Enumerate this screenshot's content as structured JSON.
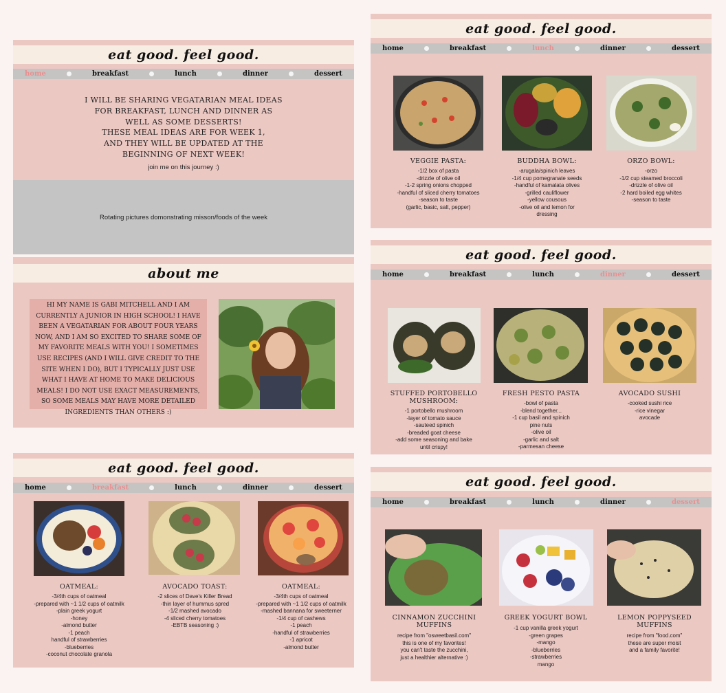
{
  "site_title": "eat good. feel good.",
  "nav": [
    "home",
    "breakfast",
    "lunch",
    "dinner",
    "dessert"
  ],
  "home": {
    "intro1": "I will be sharing vegatarian meal ideas for breakfast, lunch and dinner as well as some desserts!",
    "intro2": "These meal ideas are for week 1, and they will be updated at the beginning of next week!",
    "journey": "join me on this journey :)",
    "banner": "Rotating pictures domonstrating misson/foods of the week"
  },
  "about": {
    "title": "about me",
    "text": "Hi my name is Gabi Mitchell and I am currently a junior in high school! I have been a vegatarian for about four years now, and I am so excited to share some of my favorite meals with you! I sometimes use recipes (and I will give credit to the site when I do), but I typically just use what I have at home to make delicious meals! I do not use exact measurements, so some meals may have more detailed ingredients than others :)"
  },
  "breakfast": [
    {
      "title": "Oatmeal:",
      "lines": [
        "-3/4th cups of oatmeal",
        "-prepared with ~1 1/2 cups of oatmilk",
        "-plain greek yogurt",
        "-honey",
        "-almond butter",
        "-1 peach",
        "handful of strawberries",
        "-blueberries",
        "-coconut chocolate granola"
      ]
    },
    {
      "title": "Avocado Toast:",
      "lines": [
        "-2 slices of Dave's Killer Bread",
        "-thin layer of hummus spred",
        "-1/2 mashed avocado",
        "-4 sliced cherry tomatoes",
        "-EBTB seasoning :)"
      ]
    },
    {
      "title": "Oatmeal:",
      "lines": [
        "-3/4th cups of oatmeal",
        "-prepared with ~1 1/2 cups of oatmilk",
        "-mashed bannana for sweeterner",
        "-1/4 cup of cashews",
        "-1 peach",
        "-handful of strawberries",
        "-1 apricot",
        "-almond butter"
      ]
    }
  ],
  "lunch": [
    {
      "title": "Veggie Pasta:",
      "lines": [
        "-1/2 box of pasta",
        "-drizzle of olive oil",
        "-1-2 spring onions chopped",
        "-handful of sliced cherry tomatoes",
        "-season to taste",
        "(garlic, basic, salt, pepper)"
      ]
    },
    {
      "title": "Buddha Bowl:",
      "lines": [
        "-arugala/spinich leaves",
        "-1/4 cup pomegranate seeds",
        "-handful of kamalata olives",
        "-grilled cauliflower",
        "-yellow cousous",
        "-olive oil and lemon for",
        "dressing"
      ]
    },
    {
      "title": "orzo bowl:",
      "lines": [
        "-orzo",
        "-1/2 cup steamed broccoli",
        "-drizzle of olive oil",
        "-2 hard boiled egg whites",
        "-season to taste"
      ]
    }
  ],
  "dinner": [
    {
      "title": "Stuffed Portobello Mushroom:",
      "lines": [
        "-1 portobello mushroom",
        "-layer of tomato sauce",
        "-sauteed spinich",
        "-breaded goat cheese",
        "-add some seasoning and bake",
        "until crispy!"
      ]
    },
    {
      "title": "Fresh Pesto Pasta",
      "lines": [
        "-bowl of pasta",
        "-blend together...",
        "-1 cup basil and spinich",
        "pine nuts",
        "-olive oil",
        "-garlic and salt",
        "-parmesan cheese"
      ]
    },
    {
      "title": "Avocado Sushi",
      "lines": [
        "-cooked sushi rice",
        "-rice vinegar",
        "avocade"
      ]
    }
  ],
  "dessert": [
    {
      "title": "Cinnamon Zucchini Muffins",
      "lines": [
        "recipe from \"osweetbasil.com\"",
        "this is one of my favorites!",
        "you can't taste the zucchini,",
        "just a healthier alternative :)"
      ]
    },
    {
      "title": "Greek Yogurt Bowl",
      "lines": [
        "-1 cup vanilla greek yogurt",
        "-green grapes",
        "-mango",
        "-blueberries",
        "-strawberries",
        "mango"
      ]
    },
    {
      "title": "Lemon Poppyseed Muffins",
      "lines": [
        "recipe from \"food.com\"",
        "these are super moist",
        "and a family favorite!"
      ]
    }
  ]
}
